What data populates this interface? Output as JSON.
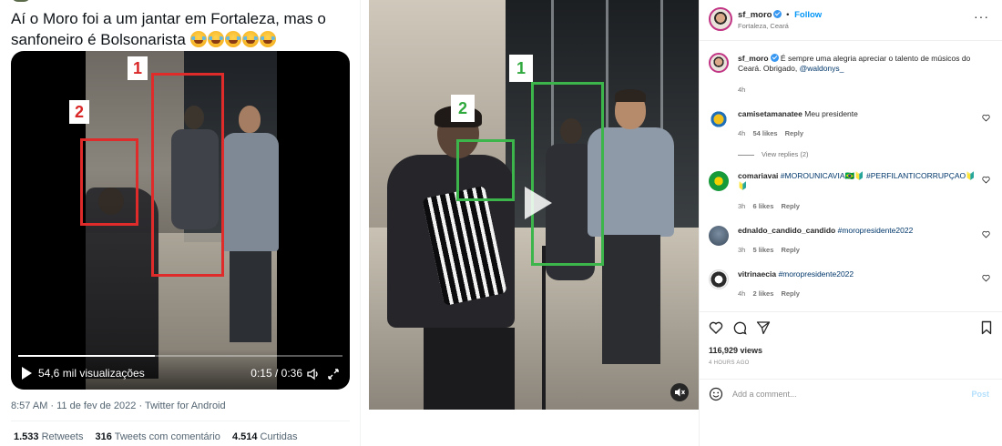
{
  "tweet": {
    "text": "Aí o Moro foi a um jantar em Fortaleza, mas o sanfoneiro é Bolsonarista",
    "emoji_count": 5,
    "video": {
      "views": "54,6 mil visualizações",
      "time": "0:15 / 0:36",
      "progress": 0.42,
      "annotation_labels": [
        "1",
        "2"
      ]
    },
    "meta": "8:57 AM · 11 de fev de 2022 · Twitter for Android",
    "stats": {
      "retweets_count": "1.533",
      "retweets_label": "Retweets",
      "comments_count": "316",
      "comments_label": "Tweets com comentário",
      "likes_count": "4.514",
      "likes_label": "Curtidas"
    }
  },
  "ig_media": {
    "annotation_labels": [
      "1",
      "2"
    ]
  },
  "ig": {
    "header": {
      "username": "sf_moro",
      "separator": "•",
      "follow": "Follow",
      "location": "Fortaleza, Ceará",
      "more": "···"
    },
    "caption": {
      "username": "sf_moro",
      "text": "É sempre uma alegria apreciar o talento de músicos do Ceará. Obrigado,",
      "mention": "@waldonys_",
      "time": "4h"
    },
    "comments": [
      {
        "username": "camisetamanatee",
        "text": "Meu presidente",
        "tag": "",
        "time": "4h",
        "likes": "54 likes",
        "reply": "Reply",
        "view_replies": "View replies (2)"
      },
      {
        "username": "comariavai",
        "text": "",
        "tag": "#MOROUNICAVIA🇧🇷🔰 #PERFILANTICORRUPÇAO🔰 🔰",
        "time": "3h",
        "likes": "6 likes",
        "reply": "Reply"
      },
      {
        "username": "ednaldo_candido_candido",
        "text": "",
        "tag": "#moropresidente2022",
        "time": "3h",
        "likes": "5 likes",
        "reply": "Reply"
      },
      {
        "username": "vitrinaecia",
        "text": "",
        "tag": "#moropresidente2022",
        "time": "4h",
        "likes": "2 likes",
        "reply": "Reply"
      }
    ],
    "views": "116,929 views",
    "posted": "4 HOURS AGO",
    "comment_placeholder": "Add a comment...",
    "post_label": "Post"
  },
  "colors": {
    "twitter_red_box": "#e02b2b",
    "ig_green_box": "#3cb54a",
    "ig_blue": "#0095f6",
    "ig_verified": "#3897f0"
  },
  "icons": {
    "tweet_video": [
      "play-icon",
      "volume-icon",
      "fullscreen-icon"
    ],
    "ig_actions": [
      "heart-icon",
      "comment-icon",
      "share-icon",
      "bookmark-icon"
    ],
    "ig_other": [
      "verified-icon",
      "more-icon",
      "emoji-icon",
      "mute-icon"
    ]
  }
}
